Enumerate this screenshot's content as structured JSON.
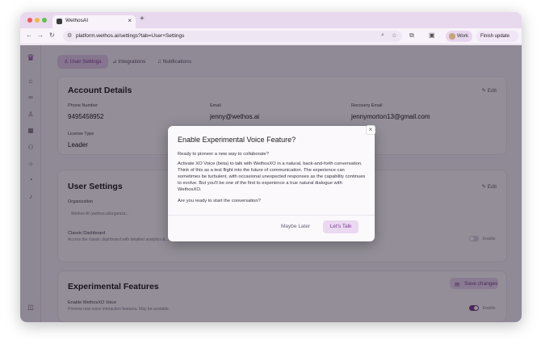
{
  "browser": {
    "tab_title": "WethosAI",
    "tab_close": "×",
    "new_tab": "+",
    "url": "platform.wethos.ai/settings?tab=User+Settings",
    "profile_label": "Work",
    "finish_update_label": "Finish update"
  },
  "page": {
    "tabs": [
      {
        "label": "User Settings"
      },
      {
        "label": "Integrations"
      },
      {
        "label": "Notifications"
      }
    ]
  },
  "account": {
    "title": "Account Details",
    "edit_label": "Edit",
    "phone_label": "Phone Number",
    "phone_value": "9495458952",
    "email_label": "Email",
    "email_value": "jenny@wethos.ai",
    "recovery_label": "Recovery Email",
    "recovery_value": "jennymorton13@gmail.com",
    "license_label": "License Type",
    "license_value": "Leader"
  },
  "user_settings": {
    "title": "User Settings",
    "edit_label": "Edit",
    "org_label": "Organization",
    "org_value": "Wethos AI (wethos.ai/organiza...",
    "classic_label": "Classic Dashboard",
    "classic_desc": "Access the classic dashboard with detailed analytics &...",
    "classic_toggle_label": "Enable",
    "classic_toggle_on": false
  },
  "experimental": {
    "title": "Experimental Features",
    "save_label": "Save changes",
    "voice_label": "Enable WethosXO Voice",
    "voice_desc": "Preview new voice interaction features. May be unstable.",
    "voice_toggle_label": "Enable",
    "voice_toggle_on": true
  },
  "modal": {
    "title": "Enable Experimental Voice Feature?",
    "close": "×",
    "intro": "Ready to pioneer a new way to collaborate?",
    "body": "Activate XO Voice (beta) to talk with WethosXO in a natural, back-and-forth conversation. Think of this as a test flight into the future of communication. The experience can sometimes be turbulent, with occasional unexpected responses as the capability continues to evolve. But you'll be one of the first to experience a true natural dialogue with WethosXO.",
    "question": "Are you ready to start the conversation?",
    "maybe_label": "Maybe Later",
    "talk_label": "Let's Talk"
  },
  "colors": {
    "accent": "#7a3e8c",
    "accent_light": "#ead9f0",
    "toggle_on": "#7a3e8c"
  }
}
